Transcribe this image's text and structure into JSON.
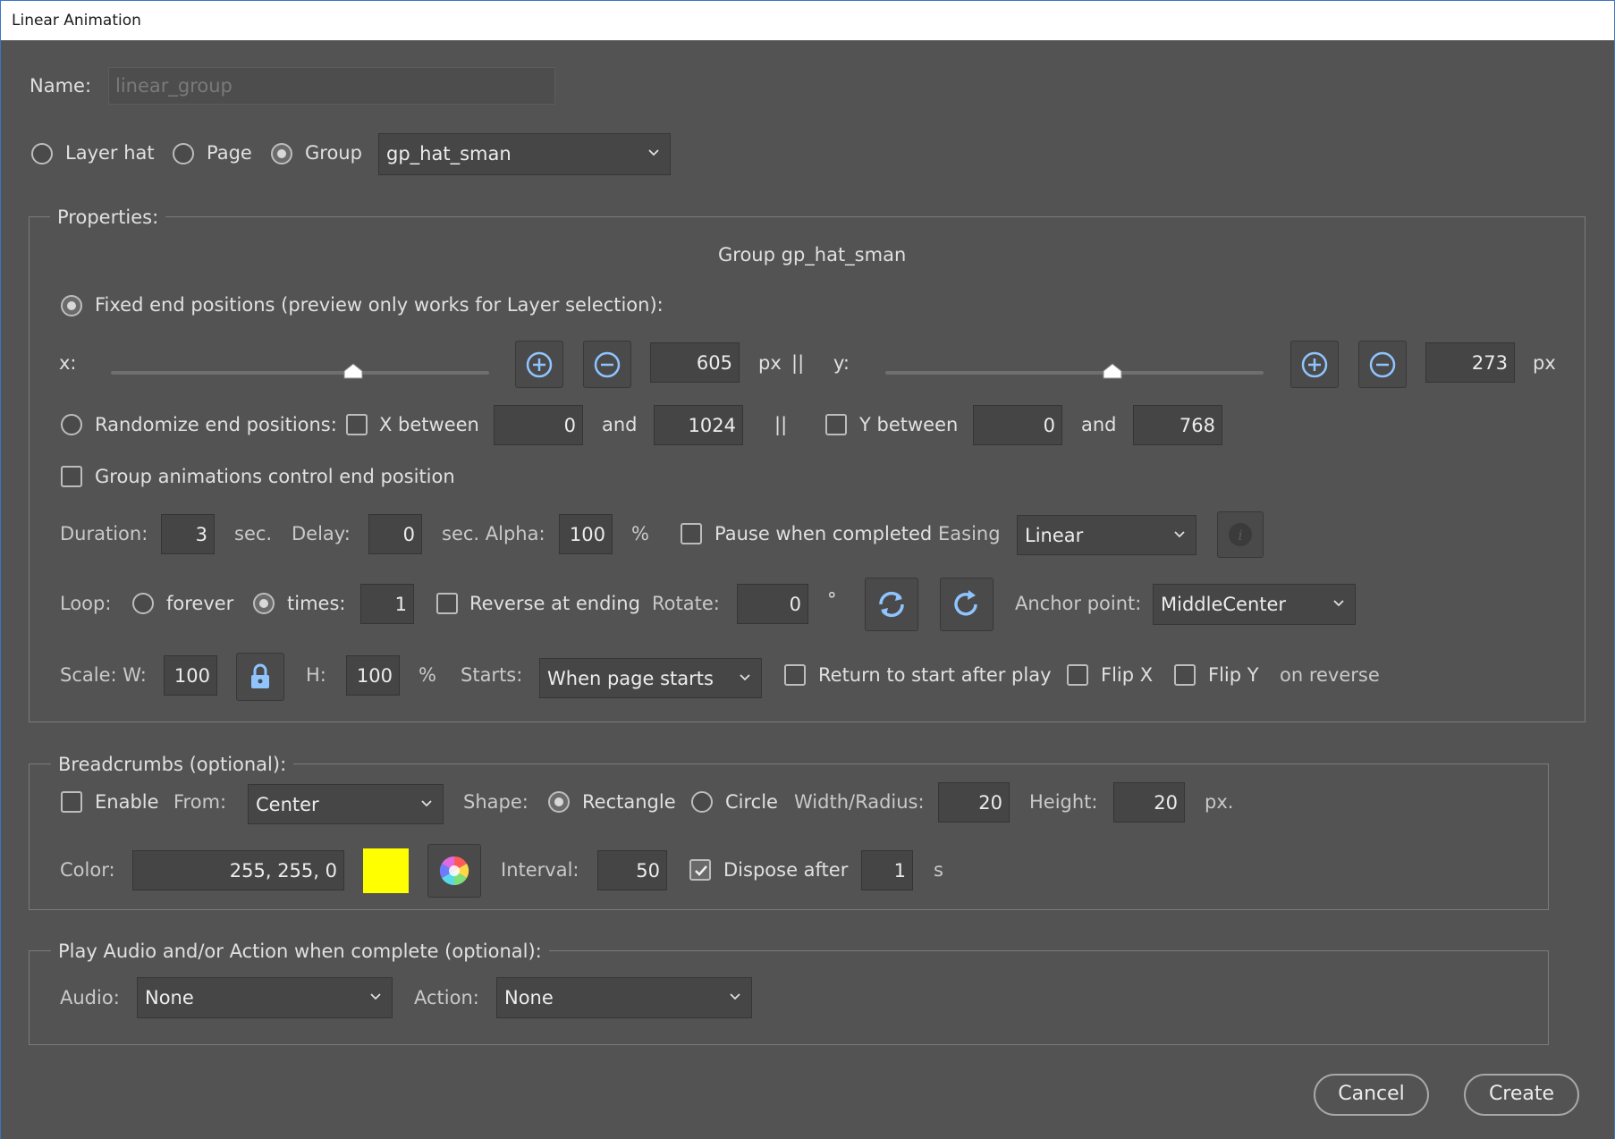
{
  "window": {
    "title": "Linear Animation"
  },
  "name": {
    "label": "Name:",
    "placeholder": "linear_group"
  },
  "target": {
    "options": [
      "Layer hat",
      "Page",
      "Group"
    ],
    "selected": "Group",
    "group_select": "gp_hat_sman"
  },
  "properties": {
    "title": "Properties:",
    "subtitle": "Group gp_hat_sman",
    "fixed_label": "Fixed end positions (preview only works for Layer selection):",
    "x_label": "x:",
    "x_value": "605",
    "x_unit": "px",
    "separator": "||",
    "y_label": "y:",
    "y_value": "273",
    "y_unit": "px",
    "x_slider_level": 0.64,
    "y_slider_level": 0.6,
    "random_label": "Randomize end positions:",
    "x_between_label": "X between",
    "x_min": "0",
    "and1": "and",
    "x_max": "1024",
    "y_between_label": "Y between",
    "y_min": "0",
    "and2": "and",
    "y_max": "768",
    "group_control_label": "Group animations control end position",
    "duration_label": "Duration:",
    "duration_value": "3",
    "sec1": "sec.",
    "delay_label": "Delay:",
    "delay_value": "0",
    "alpha_label": "sec. Alpha:",
    "alpha_value": "100",
    "percent1": "%",
    "pause_label": "Pause when completed",
    "easing_label": "Easing",
    "easing_value": "Linear",
    "loop_label": "Loop:",
    "forever_label": "forever",
    "times_label": "times:",
    "times_value": "1",
    "reverse_label": "Reverse at ending",
    "rotate_label": "Rotate:",
    "rotate_value": "0",
    "degree": "°",
    "anchor_label": "Anchor point:",
    "anchor_value": "MiddleCenter",
    "scale_w_label": "Scale: W:",
    "scale_w_value": "100",
    "scale_h_label": "H:",
    "scale_h_value": "100",
    "percent2": "%",
    "starts_label": "Starts:",
    "starts_value": "When page starts",
    "return_label": "Return to start after play",
    "flipx_label": "Flip X",
    "flipy_label": "Flip Y",
    "on_reverse_label": "on reverse"
  },
  "breadcrumbs": {
    "title": "Breadcrumbs (optional):",
    "enable_label": "Enable",
    "from_label": "From:",
    "from_value": "Center",
    "shape_label": "Shape:",
    "rectangle_label": "Rectangle",
    "circle_label": "Circle",
    "width_label": "Width/Radius:",
    "width_value": "20",
    "height_label": "Height:",
    "height_value": "20",
    "px_label": "px.",
    "color_label": "Color:",
    "color_value": "255, 255, 0",
    "swatch_color": "#ffff00",
    "interval_label": "Interval:",
    "interval_value": "50",
    "dispose_label": "Dispose after",
    "dispose_value": "1",
    "s_label": "s"
  },
  "completion": {
    "title": "Play Audio and/or Action when complete (optional):",
    "audio_label": "Audio:",
    "audio_value": "None",
    "action_label": "Action:",
    "action_value": "None"
  },
  "buttons": {
    "cancel": "Cancel",
    "create": "Create"
  }
}
